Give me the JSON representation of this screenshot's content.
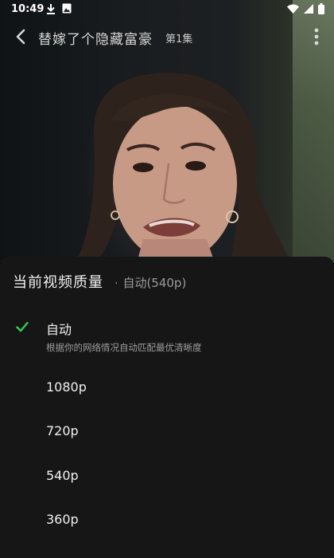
{
  "status_bar": {
    "time": "10:49",
    "left_icons": [
      "download-icon",
      "gallery-icon"
    ],
    "right_icons": [
      "wifi-icon",
      "signal-icon",
      "battery-icon"
    ]
  },
  "player": {
    "back_icon": "back-arrow-icon",
    "title": "替嫁了个隐藏富豪",
    "episode": "第1集",
    "more_icon": "more-vertical-icon"
  },
  "quality_sheet": {
    "title": "当前视频质量",
    "separator": "·",
    "current": "自动(540p)",
    "accent_color": "#2fd24a",
    "options": [
      {
        "label": "自动",
        "description": "根据你的网络情况自动匹配最优清晰度",
        "selected": true
      },
      {
        "label": "1080p",
        "selected": false
      },
      {
        "label": "720p",
        "selected": false
      },
      {
        "label": "540p",
        "selected": false
      },
      {
        "label": "360p",
        "selected": false
      }
    ]
  }
}
